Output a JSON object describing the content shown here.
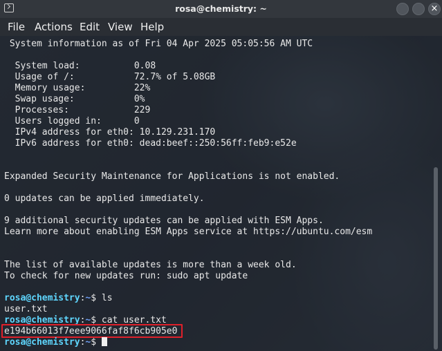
{
  "window": {
    "title": "rosa@chemistry: ~",
    "close_glyph": "×"
  },
  "menu": {
    "file": "File",
    "actions": "Actions",
    "edit": "Edit",
    "view": "View",
    "help": "Help"
  },
  "terminal": {
    "sysinfo_header": " System information as of Fri 04 Apr 2025 05:05:56 AM UTC",
    "stats": [
      {
        "label": "  System load:          ",
        "value": "0.08"
      },
      {
        "label": "  Usage of /:           ",
        "value": "72.7% of 5.08GB"
      },
      {
        "label": "  Memory usage:         ",
        "value": "22%"
      },
      {
        "label": "  Swap usage:           ",
        "value": "0%"
      },
      {
        "label": "  Processes:            ",
        "value": "229"
      },
      {
        "label": "  Users logged in:      ",
        "value": "0"
      },
      {
        "label": "  IPv4 address for eth0: ",
        "value": "10.129.231.170"
      },
      {
        "label": "  IPv6 address for eth0: ",
        "value": "dead:beef::250:56ff:feb9:e52e"
      }
    ],
    "esm_notice": "Expanded Security Maintenance for Applications is not enabled.",
    "updates_now": "0 updates can be applied immediately.",
    "security_updates": "9 additional security updates can be applied with ESM Apps.",
    "esm_learn_more": "Learn more about enabling ESM Apps service at https://ubuntu.com/esm",
    "list_old": "The list of available updates is more than a week old.",
    "check_updates": "To check for new updates run: sudo apt update",
    "prompt": {
      "user_host": "rosa@chemistry",
      "sep": ":",
      "path": "~",
      "dollar": "$ "
    },
    "cmd_ls": "ls",
    "ls_output": "user.txt",
    "cmd_cat": "cat user.txt",
    "flag_output": "e194b66013f7eee9066faf8f6cb905e0"
  }
}
